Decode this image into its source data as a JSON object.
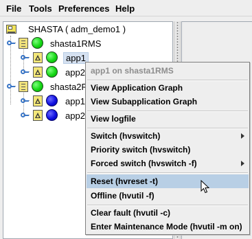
{
  "menubar": {
    "items": [
      {
        "label": "File"
      },
      {
        "label": "Tools"
      },
      {
        "label": "Preferences"
      },
      {
        "label": "Help"
      }
    ]
  },
  "tree": {
    "root": {
      "label": "SHASTA ( adm_demo1 )",
      "icon": "server-icon"
    },
    "nodes": [
      {
        "label": "shasta1RMS",
        "status": "green",
        "icon": "node-book-icon"
      },
      {
        "label": "app1",
        "status": "green",
        "icon": "warning-icon",
        "selected": true
      },
      {
        "label": "app2",
        "status": "green",
        "icon": "warning-icon"
      },
      {
        "label": "shasta2R",
        "status": "green",
        "icon": "node-book-icon"
      },
      {
        "label": "app1",
        "status": "blue",
        "icon": "warning-icon"
      },
      {
        "label": "app2",
        "status": "blue",
        "icon": "warning-icon"
      }
    ]
  },
  "context_menu": {
    "header": "app1 on shasta1RMS",
    "items": [
      {
        "label": "View Application Graph"
      },
      {
        "label": "View Subapplication Graph"
      },
      {
        "label": "View logfile"
      },
      {
        "label": "Switch (hvswitch)",
        "submenu": true
      },
      {
        "label": "Priority switch (hvswitch)"
      },
      {
        "label": "Forced switch (hvswitch -f)",
        "submenu": true
      },
      {
        "label": "Reset (hvreset -t)",
        "hovered": true
      },
      {
        "label": "Offline (hvutil -f)"
      },
      {
        "label": "Clear fault (hvutil -c)"
      },
      {
        "label": "Enter Maintenance Mode (hvutil -m on)"
      }
    ]
  },
  "colors": {
    "status_green": "#15d815",
    "status_blue": "#1010e0",
    "hover_bg": "#b8cfe5",
    "selection_bg": "#d5e1f1"
  }
}
